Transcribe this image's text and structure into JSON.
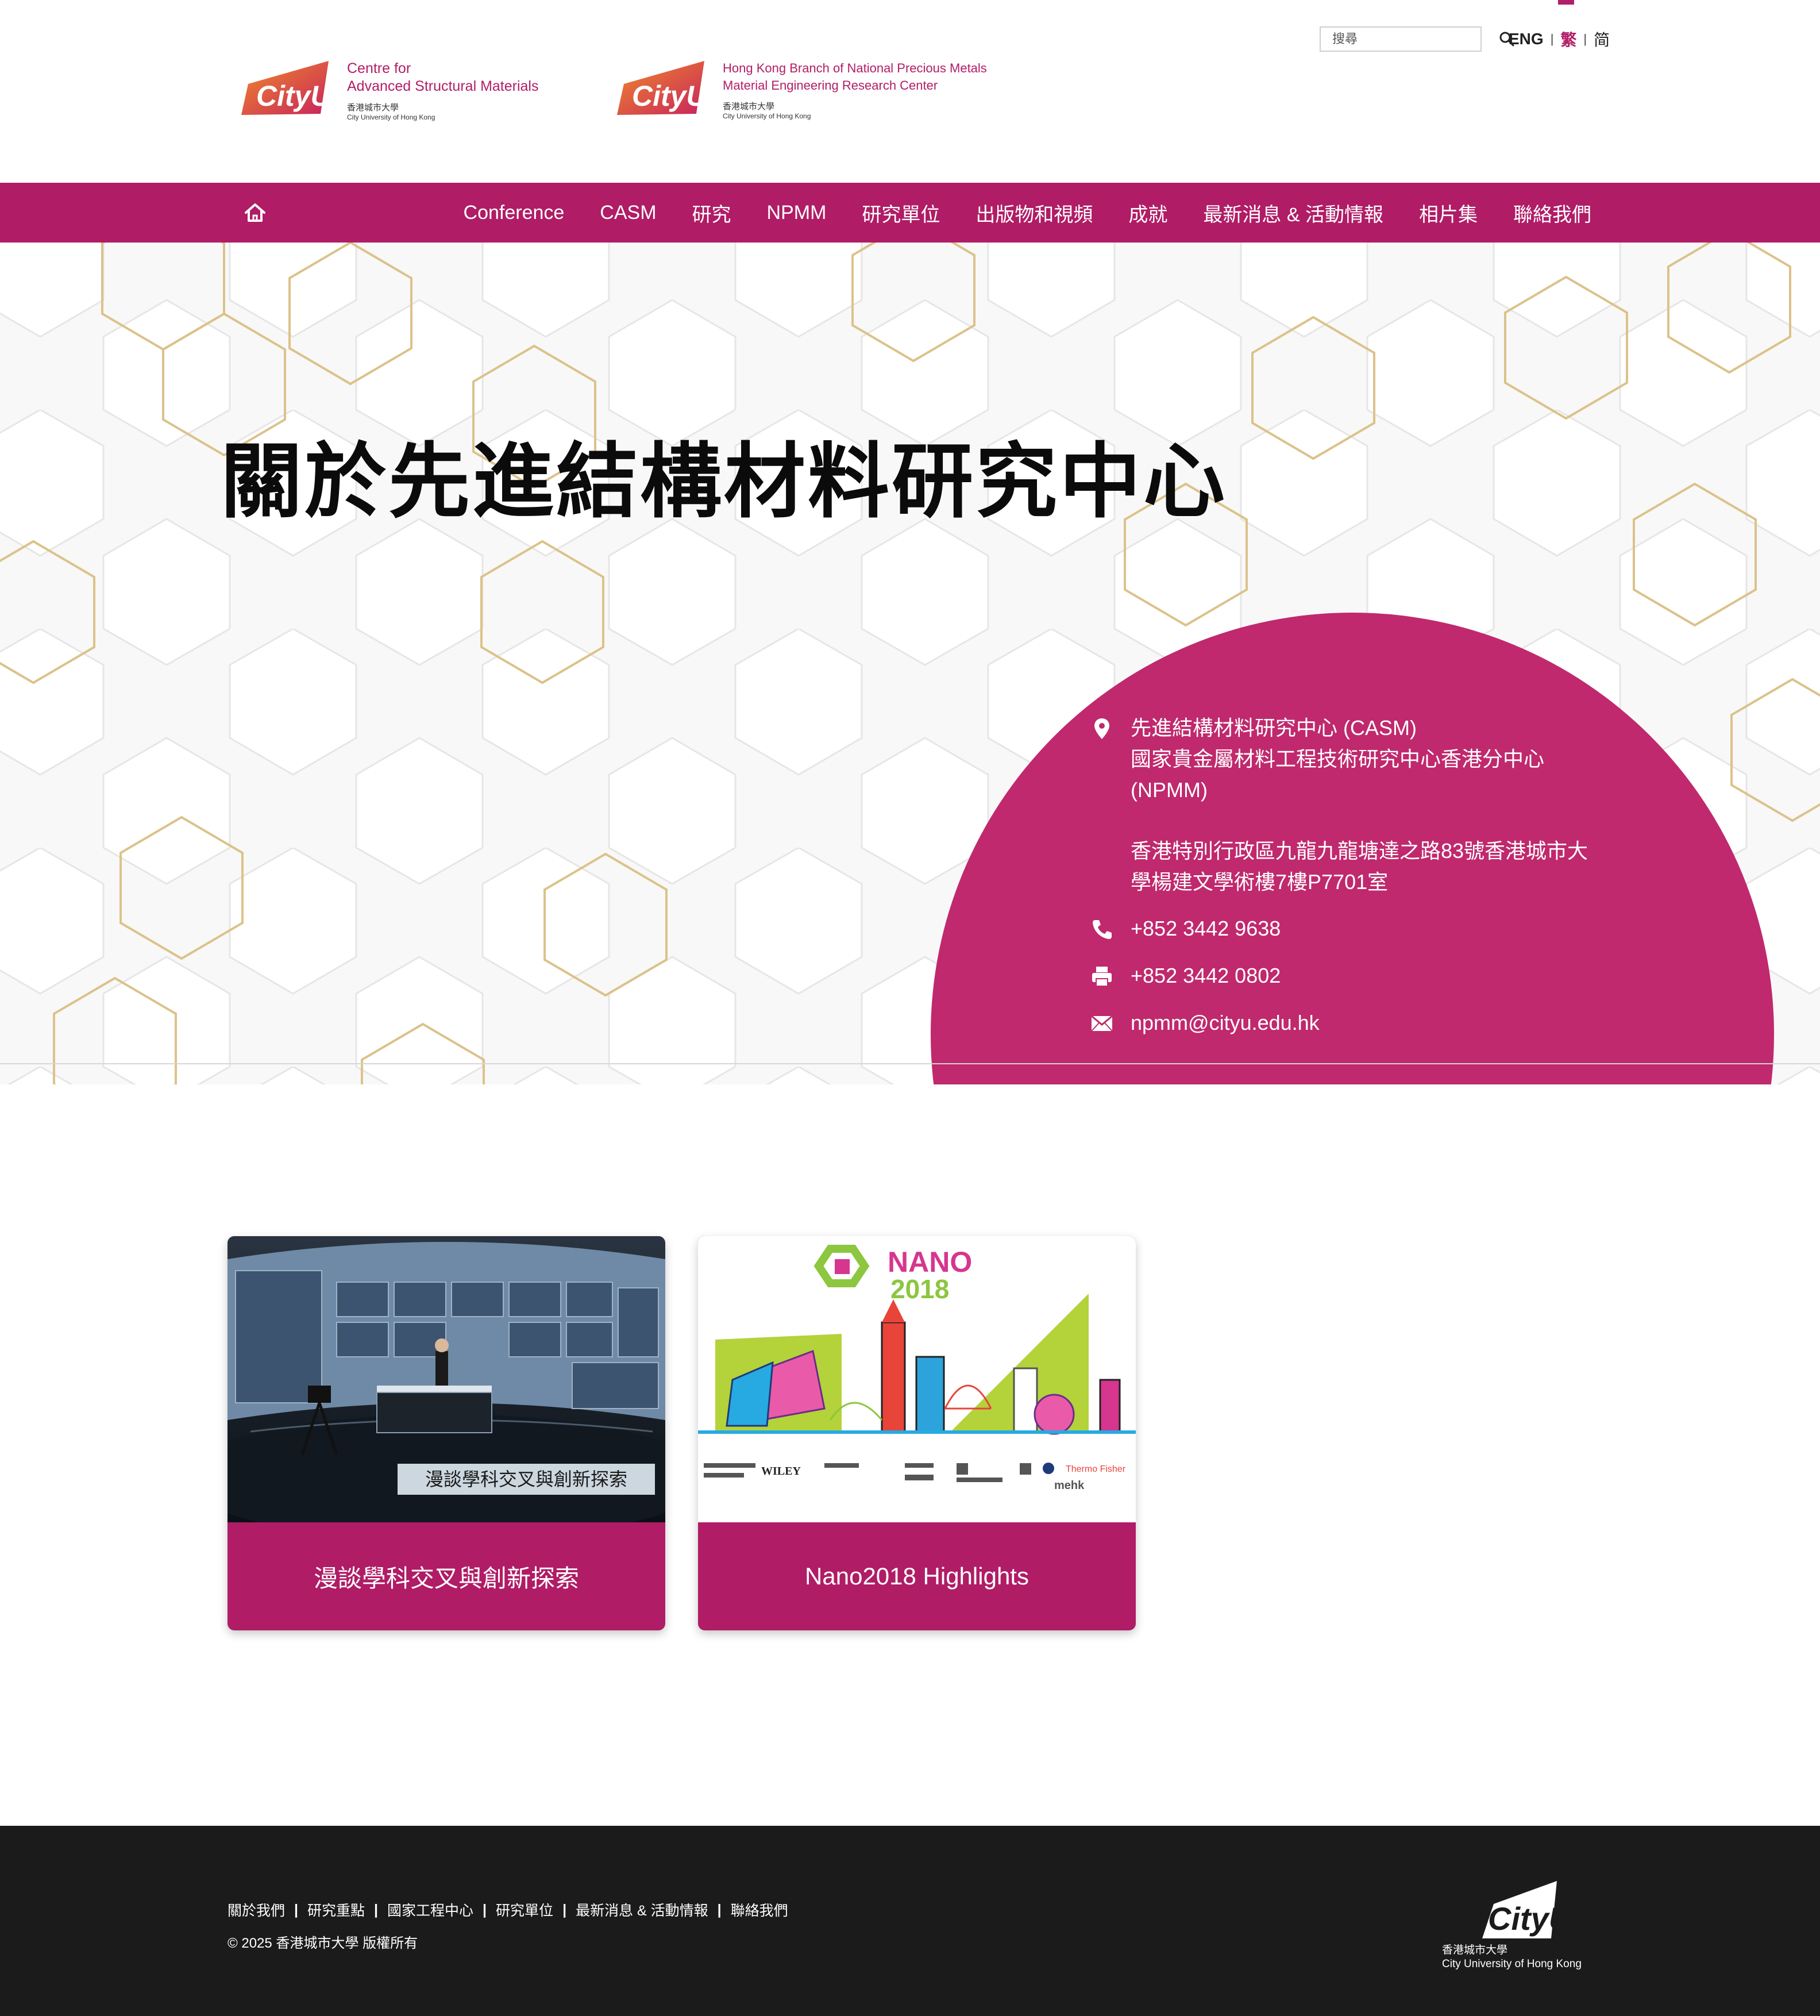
{
  "header": {
    "logo1": {
      "brand": "CityU",
      "line1": "Centre for",
      "line2": "Advanced Structural Materials",
      "sub_zh": "香港城市大學",
      "sub_en": "City University of Hong Kong"
    },
    "logo2": {
      "brand": "CityU",
      "line1": "Hong Kong Branch of National Precious Metals",
      "line2": "Material Engineering Research Center",
      "sub_zh": "香港城市大學",
      "sub_en": "City University of Hong Kong"
    },
    "search": {
      "placeholder": "搜尋",
      "icon": "search-icon"
    },
    "languages": [
      {
        "label": "ENG",
        "active": false
      },
      {
        "label": "繁",
        "active": true
      },
      {
        "label": "简",
        "active": false
      }
    ]
  },
  "nav": {
    "home_icon": "home-icon",
    "items": [
      "Conference",
      "CASM",
      "研究",
      "NPMM",
      "研究單位",
      "出版物和視頻",
      "成就",
      "最新消息 & 活動情報",
      "相片集",
      "聯絡我們"
    ]
  },
  "hero": {
    "title": "關於先進結構材料研究中心",
    "contact": {
      "address_line1": "先進結構材料研究中心 (CASM)",
      "address_line2": "國家貴金屬材料工程技術研究中心香港分中心",
      "address_line3": "(NPMM)",
      "address_line4": "香港特別行政區九龍九龍塘達之路83號香港城市大",
      "address_line5": "學楊建文學術樓7樓P7701室",
      "phone": "+852 3442 9638",
      "fax": "+852 3442 0802",
      "email": "npmm@cityu.edu.hk"
    }
  },
  "cards": [
    {
      "caption": "漫談學科交叉與創新探索",
      "image_caption": "漫談學科交叉與創新探索"
    },
    {
      "caption": "Nano2018 Highlights",
      "image_title_1": "NANO",
      "image_title_2": "2018",
      "sponsor_1": "WILEY",
      "sponsor_2": "Thermo Fisher",
      "sponsor_3": "mehk"
    }
  ],
  "footer": {
    "links": [
      "關於我們",
      "研究重點",
      "國家工程中心",
      "研究單位",
      "最新消息 & 活動情報",
      "聯絡我們"
    ],
    "copyright": "© 2025 香港城市大學 版權所有",
    "logo": {
      "brand": "CityU",
      "sub_zh": "香港城市大學",
      "sub_en": "City University of Hong Kong"
    }
  },
  "colors": {
    "brand": "#b01c66",
    "contact_circle": "#c0296d",
    "footer_bg": "#1b1b1b",
    "hex_outline": "#dcc28a"
  }
}
